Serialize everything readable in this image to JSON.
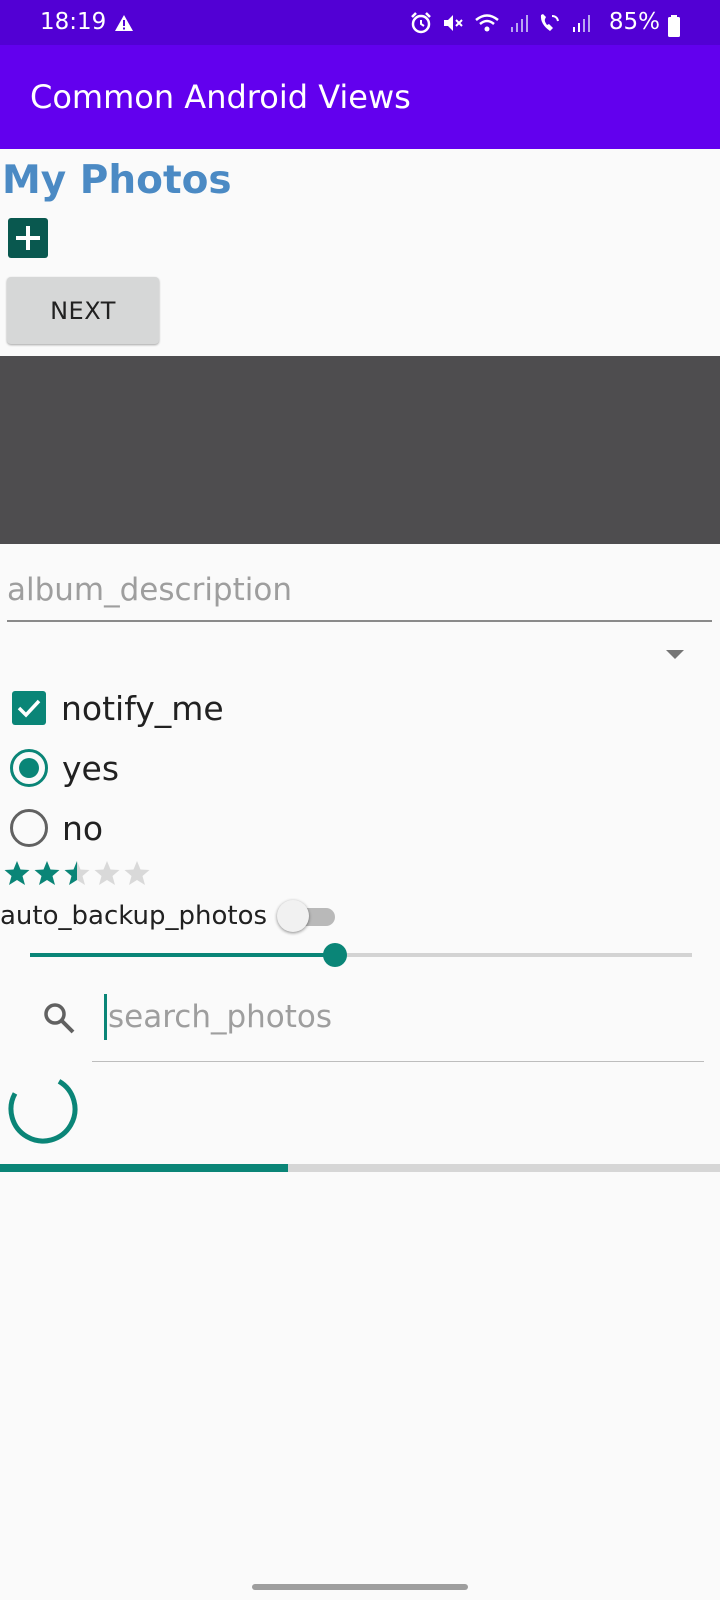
{
  "status_bar": {
    "time": "18:19",
    "battery": "85%",
    "icons": [
      "alert-triangle-icon",
      "alarm-icon",
      "mute-icon",
      "wifi-icon",
      "signal-icon",
      "wifi-calling-icon",
      "signal-icon",
      "battery-icon"
    ]
  },
  "app_bar": {
    "title": "Common Android Views"
  },
  "page": {
    "title": "My Photos"
  },
  "add_button": {
    "icon": "plus-icon"
  },
  "next_button": {
    "label": "NEXT"
  },
  "album": {
    "placeholder": "album_description",
    "value": ""
  },
  "spinner": {
    "selected": ""
  },
  "checkbox": {
    "label": "notify_me",
    "checked": true
  },
  "radios": [
    {
      "label": "yes",
      "selected": true
    },
    {
      "label": "no",
      "selected": false
    }
  ],
  "rating": {
    "value": 2.5,
    "max": 5
  },
  "switch": {
    "label": "auto_backup_photos",
    "on": false
  },
  "seek_bar": {
    "progress": 0.46
  },
  "search": {
    "placeholder": "search_photos",
    "value": ""
  },
  "progress": {
    "value": 0.4
  },
  "colors": {
    "primary": "#6200ee",
    "status_bar": "#5200d4",
    "accent": "#0a8577",
    "title_text": "#4b8ac4"
  }
}
